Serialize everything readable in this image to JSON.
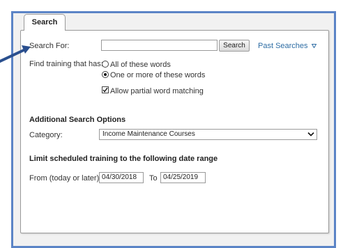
{
  "tab": {
    "label": "Search"
  },
  "search": {
    "label": "Search For:",
    "value": "",
    "button_label": "Search",
    "past_searches_label": "Past Searches",
    "past_searches_icon": "triangle-down-icon"
  },
  "find": {
    "label": "Find training that has:",
    "options": [
      {
        "label": "All of these words",
        "selected": false
      },
      {
        "label": "One or more of these words",
        "selected": true
      }
    ],
    "partial_match": {
      "label": "Allow partial word matching",
      "checked": true
    }
  },
  "additional": {
    "heading": "Additional Search Options",
    "category_label": "Category:",
    "category_value": "Income Maintenance Courses"
  },
  "date_range": {
    "heading": "Limit scheduled training to the following date range",
    "from_label": "From (today or later)",
    "from_value": "04/30/2018",
    "to_label": "To",
    "to_value": "04/25/2019"
  },
  "colors": {
    "frame_border": "#5b84c6",
    "arrow": "#2a4f8e",
    "link": "#2e6da4"
  }
}
